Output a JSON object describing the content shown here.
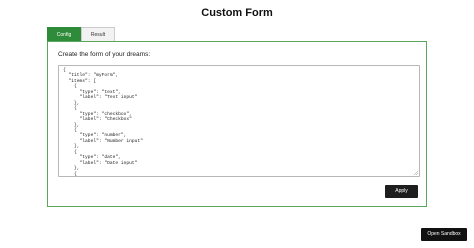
{
  "header": {
    "title": "Custom Form"
  },
  "tabs": [
    {
      "label": "Config",
      "active": true
    },
    {
      "label": "Result",
      "active": false
    }
  ],
  "config": {
    "prompt": "Create the form of your dreams:",
    "editor_value": "{\n  \"title\": \"myForm\",\n  \"items\": [\n    {\n      \"type\": \"text\",\n      \"label\": \"Text input\"\n    },\n    {\n      \"type\": \"checkbox\",\n      \"label\": \"Checkbox\"\n    },\n    {\n      \"type\": \"number\",\n      \"label\": \"Number input\"\n    },\n    {\n      \"type\": \"date\",\n      \"label\": \"Date input\"\n    },\n    {",
    "apply_label": "Apply"
  },
  "footer": {
    "sandbox_label": "Open Sandbox"
  },
  "colors": {
    "accent": "#2e8b3a",
    "panel_border": "#5aa65f",
    "button_dark": "#1e1e1e"
  }
}
